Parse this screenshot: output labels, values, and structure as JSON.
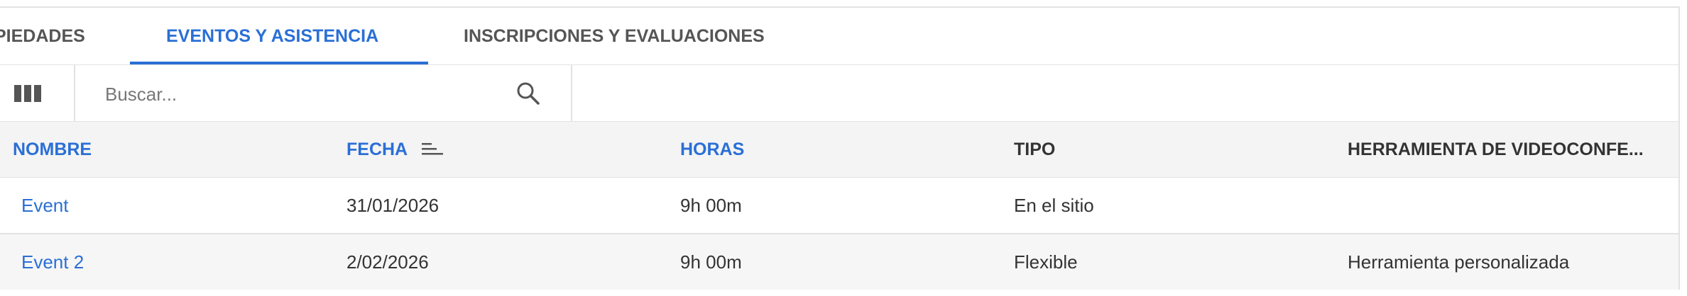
{
  "tabs": [
    {
      "label": "PIEDADES"
    },
    {
      "label": "EVENTOS Y ASISTENCIA",
      "active": true
    },
    {
      "label": "INSCRIPCIONES Y EVALUACIONES"
    }
  ],
  "toolbar": {
    "search_placeholder": "Buscar...",
    "columns_icon": "columns-icon",
    "search_icon": "search-icon"
  },
  "table": {
    "columns": [
      "NOMBRE",
      "FECHA",
      "HORAS",
      "TIPO",
      "HERRAMIENTA DE VIDEOCONFE..."
    ],
    "sorted_column": "FECHA",
    "rows": [
      {
        "nombre": "Event",
        "fecha": "31/01/2026",
        "horas": "9h 00m",
        "tipo": "En el sitio",
        "herramienta": ""
      },
      {
        "nombre": "Event 2",
        "fecha": "2/02/2026",
        "horas": "9h 00m",
        "tipo": "Flexible",
        "herramienta": "Herramienta personalizada"
      }
    ]
  },
  "colors": {
    "accent": "#2a6fd6",
    "border": "#e2e2e2",
    "header_bg": "#f4f4f4"
  }
}
